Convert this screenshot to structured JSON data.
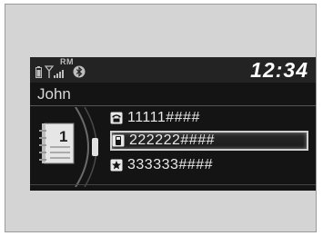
{
  "status": {
    "roaming_label": "RM",
    "clock": "12:34",
    "icons": [
      "phone-battery-icon",
      "signal-icon",
      "bluetooth-icon"
    ]
  },
  "contact": {
    "name": "John",
    "phonebook_index": "1"
  },
  "numbers": [
    {
      "icon": "home-phone-icon",
      "value": "11111####",
      "selected": false
    },
    {
      "icon": "mobile-phone-icon",
      "value": "222222####",
      "selected": true
    },
    {
      "icon": "star-icon",
      "value": "333333####",
      "selected": false
    }
  ]
}
